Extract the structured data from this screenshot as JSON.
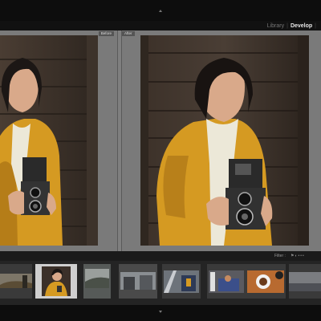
{
  "modules": {
    "library": "Library",
    "develop": "Develop"
  },
  "compare": {
    "before_label": "Before",
    "after_label": "After"
  },
  "infobar": {
    "filter_label": "Filter :"
  },
  "colors": {
    "background": "#111111",
    "workspace": "#7a7a7a",
    "filmstrip": "#242424",
    "jacket": "#d59a22",
    "wood": "#3a3029"
  },
  "filmstrip": {
    "thumbnail_count": 8,
    "selected_index": 1
  }
}
